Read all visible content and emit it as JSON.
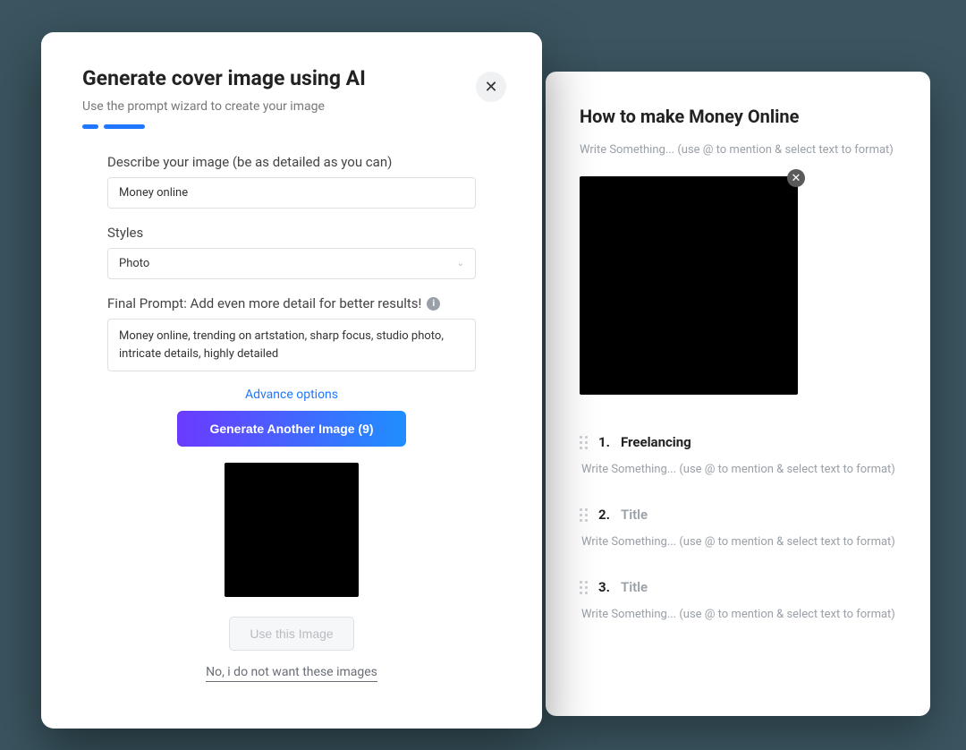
{
  "modal": {
    "title": "Generate cover image using AI",
    "subtitle": "Use the prompt wizard to create your image",
    "describe_label": "Describe your image (be as detailed as you can)",
    "describe_value": "Money online",
    "styles_label": "Styles",
    "styles_value": "Photo",
    "final_label": "Final Prompt: Add even more detail for better results!",
    "final_value": "Money online, trending on artstation, sharp focus, studio photo, intricate details, highly detailed",
    "advance_label": "Advance options",
    "generate_label": "Generate Another Image (9)",
    "use_label": "Use this Image",
    "reject_label": "No, i do not want these images"
  },
  "document": {
    "title": "How to make Money Online",
    "body_placeholder": "Write Something... (use @ to mention & select text to format)",
    "items": [
      {
        "num": "1.",
        "title": "Freelancing",
        "is_placeholder": false
      },
      {
        "num": "2.",
        "title": "Title",
        "is_placeholder": true
      },
      {
        "num": "3.",
        "title": "Title",
        "is_placeholder": true
      }
    ]
  }
}
